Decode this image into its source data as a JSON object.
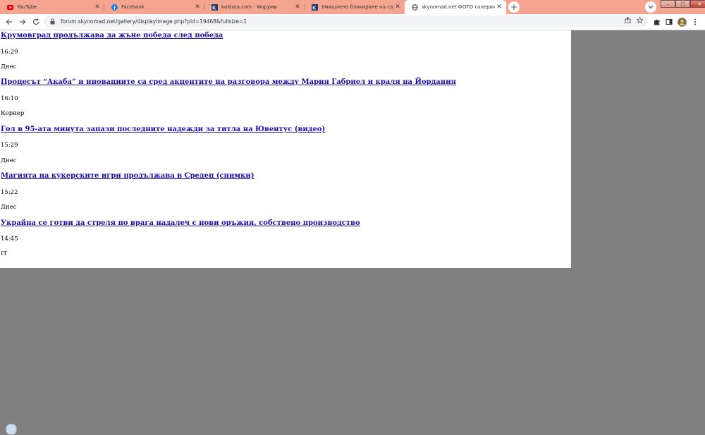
{
  "tabs": [
    {
      "title": "YouTube",
      "icon": "youtube-icon",
      "active": false
    },
    {
      "title": "Facebook",
      "icon": "facebook-icon",
      "active": false
    },
    {
      "title": "kaldata.com - Форуми",
      "icon": "kaldata-icon",
      "active": false
    },
    {
      "title": "Умишлено блокиране на сайт за",
      "icon": "kaldata-icon",
      "active": false
    },
    {
      "title": "skynomad.net ФОТО галерия: Н",
      "icon": "globe-icon",
      "active": true
    }
  ],
  "address_bar": {
    "url": "forum.skynomad.net/gallery/displayimage.php?pid=19468&fullsize=1"
  },
  "news": [
    {
      "title": "Крумовград продължава да жъне победа след победа",
      "time": "16:29",
      "source": "Днес"
    },
    {
      "title": "Процесът “Акаба” и иновациите са сред акцентите на разговора между Мария Габриел и краля на Йордания",
      "time": "16:10",
      "source": "Корнер"
    },
    {
      "title": "Гол в 95-ата минута запази последните надежди за титла на Ювентус (видео)",
      "time": "15:29",
      "source": "Днес"
    },
    {
      "title": "Магията на кукерските игри продължава в Средец (снимки)",
      "time": "15:22",
      "source": "Днес"
    },
    {
      "title": "Украйна се готви да стреля по врага надалеч с нови оръжия, собствено производство",
      "time": "14:45",
      "source": "IT"
    }
  ],
  "colors": {
    "tabstrip": "#f5a58f",
    "link": "#1a0dab",
    "backdrop": "#808080"
  }
}
